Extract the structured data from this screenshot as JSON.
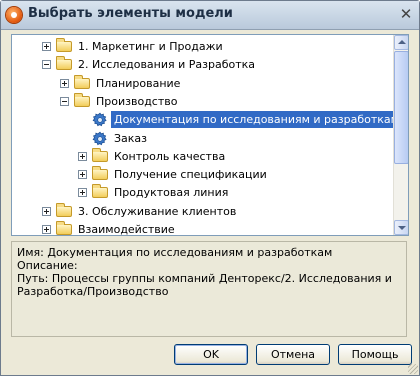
{
  "window": {
    "title": "Выбрать элементы модели"
  },
  "tree": {
    "items": [
      {
        "label": "1. Маркетинг и Продажи",
        "expander": "plus",
        "icon": "folder-icon"
      },
      {
        "label": "2. Исследования и Разработка",
        "expander": "minus",
        "icon": "folder-icon"
      },
      {
        "label": "Планирование",
        "expander": "plus",
        "icon": "folder-icon"
      },
      {
        "label": "Производство",
        "expander": "minus",
        "icon": "folder-icon"
      },
      {
        "label": "Документация по исследованиям и разработкам",
        "expander": "none",
        "icon": "gear-icon",
        "selected": true
      },
      {
        "label": "Заказ",
        "expander": "none",
        "icon": "gear-icon"
      },
      {
        "label": "Контроль качества",
        "expander": "plus",
        "icon": "folder-icon"
      },
      {
        "label": "Получение спецификации",
        "expander": "plus",
        "icon": "folder-icon"
      },
      {
        "label": "Продуктовая линия",
        "expander": "plus",
        "icon": "folder-icon"
      },
      {
        "label": "3. Обслуживание клиентов",
        "expander": "plus",
        "icon": "folder-icon"
      },
      {
        "label": "Взаимодействие",
        "expander": "plus",
        "icon": "folder-icon"
      }
    ]
  },
  "details": {
    "name_line": "Имя: Документация по исследованиям и разработкам",
    "description_line": "Описание:",
    "path_line": "Путь: Процессы группы компаний Денторекс/2. Исследования и Разработка/Производство"
  },
  "buttons": {
    "ok": "OK",
    "cancel": "Отмена",
    "help": "Помощь"
  },
  "colors": {
    "selection": "#316ac5",
    "window_bg": "#ece9d8"
  }
}
